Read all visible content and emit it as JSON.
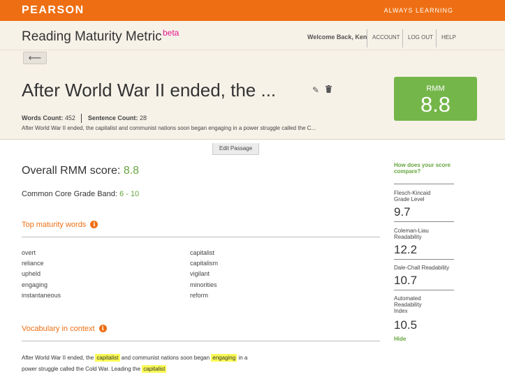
{
  "topbar": {
    "brand": "PEARSON",
    "slogan": "ALWAYS LEARNING"
  },
  "header": {
    "app_title": "Reading Maturity Metric",
    "beta": "beta",
    "welcome": "Welcome Back, Ken",
    "nav": [
      "ACCOUNT",
      "LOG OUT",
      "HELP"
    ]
  },
  "passage": {
    "back_glyph": "⟵",
    "title": "After World War II ended, the ...",
    "words_count_label": "Words Count:",
    "words_count": "452",
    "sentence_count_label": "Sentence Count:",
    "sentence_count": "28",
    "excerpt": "After World War II ended, the capitalist and communist nations soon began engaging in a power struggle called the C...",
    "edit_button": "Edit Passage"
  },
  "rmm": {
    "label": "RMM",
    "value": "8.8"
  },
  "results": {
    "overall_label": "Overall RMM score:",
    "overall_value": "8.8",
    "grade_label": "Common Core Grade Band:",
    "grade_value": "6 - 10",
    "top_words_heading": "Top maturity words",
    "top_words_col1": [
      "overt",
      "reliance",
      "upheld",
      "engaging",
      "instantaneous"
    ],
    "top_words_col2": [
      "capitalist",
      "capitalism",
      "vigilant",
      "minorities",
      "reform"
    ],
    "vocab_heading": "Vocabulary in context",
    "vocab_text": {
      "p1": "After World War II ended, the ",
      "h1": "capitalist",
      "p2": " and communist nations soon began ",
      "h2": "engaging",
      "p3": " in a power struggle called the Cold War. Leading the ",
      "h3": "capitalist"
    }
  },
  "compare": {
    "heading": "How does your score compare?",
    "metrics": [
      {
        "label": "Flesch-Kincaid Grade Level",
        "value": "9.7"
      },
      {
        "label": "Coleman-Liau Readability",
        "value": "12.2"
      },
      {
        "label": "Dale-Chall Readability",
        "value": "10.7"
      },
      {
        "label": "Automated Readability Index",
        "value": "10.5"
      }
    ],
    "hide": "Hide"
  },
  "icons": {
    "info": "i",
    "edit": "✎",
    "trash": "🗑"
  },
  "colors": {
    "brand_orange": "#ee6f13",
    "accent_green": "#74b649",
    "beta_pink": "#e0148c",
    "highlight": "#fafa55"
  }
}
